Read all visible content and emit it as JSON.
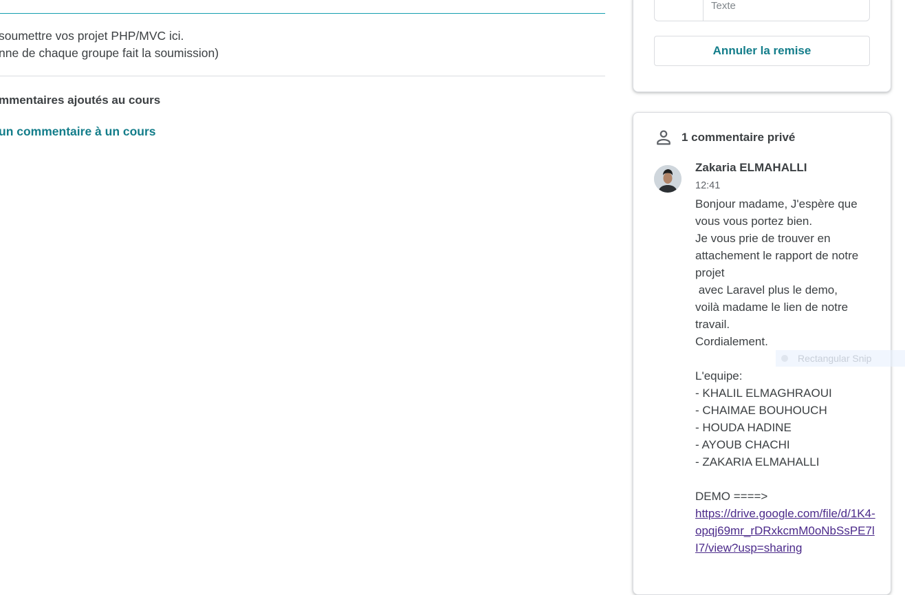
{
  "assignment": {
    "description_lines": [
      "soumettre vos projet PHP/MVC ici.",
      "nne de chaque groupe fait la soumission)"
    ],
    "class_comments_label": "mmentaires ajoutés au cours",
    "add_class_comment_label": "un commentaire à un cours"
  },
  "work_card": {
    "text_field_label": "Texte",
    "cancel_button_label": "Annuler la remise"
  },
  "private_comments": {
    "header_icon": "person-icon",
    "title": "1 commentaire privé",
    "comment": {
      "author": "Zakaria ELMAHALLI",
      "time": "12:41",
      "lines": [
        "Bonjour madame, J'espère que",
        "vous vous portez bien.",
        "Je vous prie de trouver en",
        "attachement le rapport de notre",
        "projet",
        " avec Laravel plus le demo,",
        "voilà madame le lien de notre",
        "travail.",
        "Cordialement.",
        "",
        "L'equipe:",
        "- KHALIL ELMAGHRAOUI",
        "- CHAIMAE BOUHOUCH",
        "- HOUDA HADINE",
        "- AYOUB CHACHI",
        "- ZAKARIA ELMAHALLI",
        "",
        "DEMO ====>"
      ],
      "link": "https://drive.google.com/file/d/1K4-opqj69mr_rDRxkcmM0oNbSsPE7lI7/view?usp=sharing"
    }
  },
  "overlay": {
    "snip_label": "Rectangular Snip"
  },
  "colors": {
    "accent": "#137d8a",
    "link_visited": "#4b2a8a",
    "divider": "#dadce0"
  }
}
